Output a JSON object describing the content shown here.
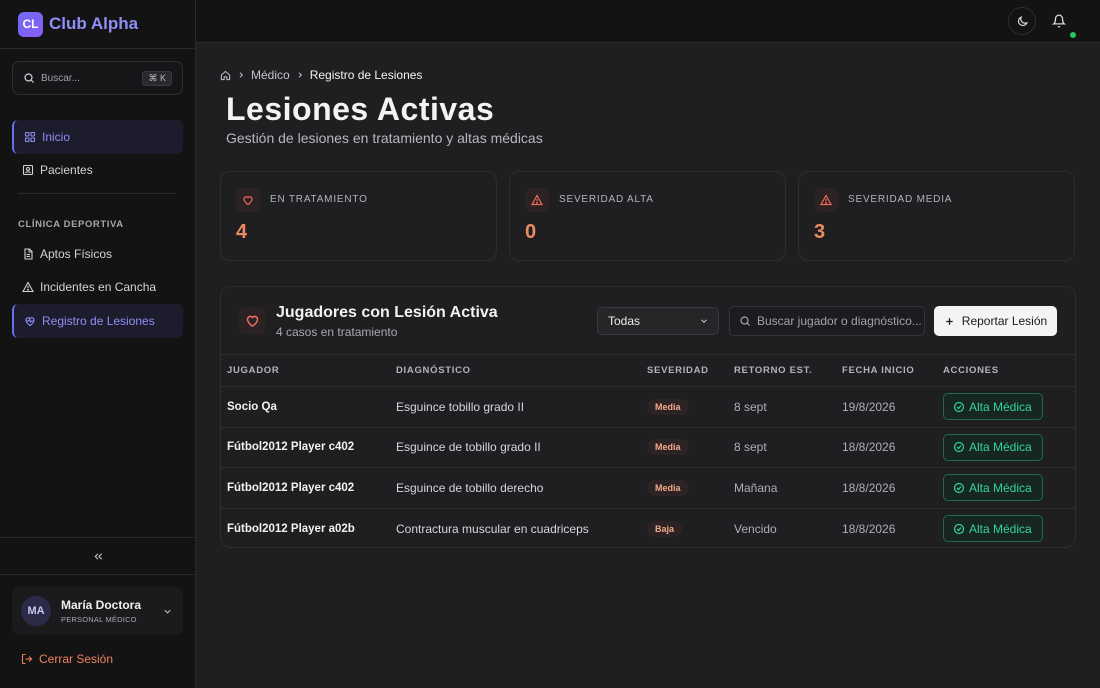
{
  "brand": {
    "logo": "CL",
    "name": "Club Alpha"
  },
  "sidebar": {
    "search_placeholder": "Buscar...",
    "search_shortcut": "⌘ K",
    "items": [
      {
        "label": "Inicio",
        "icon": "grid-icon",
        "active": true
      },
      {
        "label": "Pacientes",
        "icon": "id-card-icon",
        "active": false
      }
    ],
    "section_title": "CLÍNICA DEPORTIVA",
    "section_items": [
      {
        "label": "Aptos Físicos",
        "icon": "document-icon",
        "active": false
      },
      {
        "label": "Incidentes en Cancha",
        "icon": "warning-icon",
        "active": false
      },
      {
        "label": "Registro de Lesiones",
        "icon": "heart-pulse-icon",
        "active": true
      }
    ],
    "user": {
      "initials": "MA",
      "name": "María Doctora",
      "role": "PERSONAL MÉDICO"
    },
    "logout_label": "Cerrar Sesión"
  },
  "breadcrumb": {
    "level1": "Médico",
    "level2": "Registro de Lesiones"
  },
  "page": {
    "title": "Lesiones Activas",
    "subtitle": "Gestión de lesiones en tratamiento y altas médicas"
  },
  "stats": [
    {
      "label": "EN TRATAMIENTO",
      "value": "4",
      "icon": "heart-icon"
    },
    {
      "label": "SEVERIDAD ALTA",
      "value": "0",
      "icon": "warning-icon"
    },
    {
      "label": "SEVERIDAD MEDIA",
      "value": "3",
      "icon": "warning-icon"
    }
  ],
  "panel": {
    "title": "Jugadores con Lesión Activa",
    "subtitle": "4 casos en tratamiento",
    "filter_value": "Todas",
    "search_placeholder": "Buscar jugador o diagnóstico...",
    "report_label": "Reportar Lesión",
    "columns": [
      "JUGADOR",
      "DIAGNÓSTICO",
      "SEVERIDAD",
      "RETORNO EST.",
      "FECHA INICIO",
      "ACCIONES"
    ],
    "rows": [
      {
        "player": "Socio Qa",
        "diagnosis": "Esguince tobillo grado II",
        "severity": "Media",
        "return": "8 sept",
        "start": "19/8/2026",
        "action": "Alta Médica"
      },
      {
        "player": "Fútbol2012 Player c402",
        "diagnosis": "Esguince de tobillo grado II",
        "severity": "Media",
        "return": "8 sept",
        "start": "18/8/2026",
        "action": "Alta Médica"
      },
      {
        "player": "Fútbol2012 Player c402",
        "diagnosis": "Esguince de tobillo derecho",
        "severity": "Media",
        "return": "Mañana",
        "start": "18/8/2026",
        "action": "Alta Médica"
      },
      {
        "player": "Fútbol2012 Player a02b",
        "diagnosis": "Contractura muscular en cuadriceps",
        "severity": "Baja",
        "return": "Vencido",
        "start": "18/8/2026",
        "action": "Alta Médica"
      }
    ]
  },
  "colors": {
    "accent": "#8f8ff7",
    "stat_value": "#ec8b62",
    "success": "#34d399",
    "logout": "#f0825f",
    "notification_dot": "#22c55e"
  }
}
